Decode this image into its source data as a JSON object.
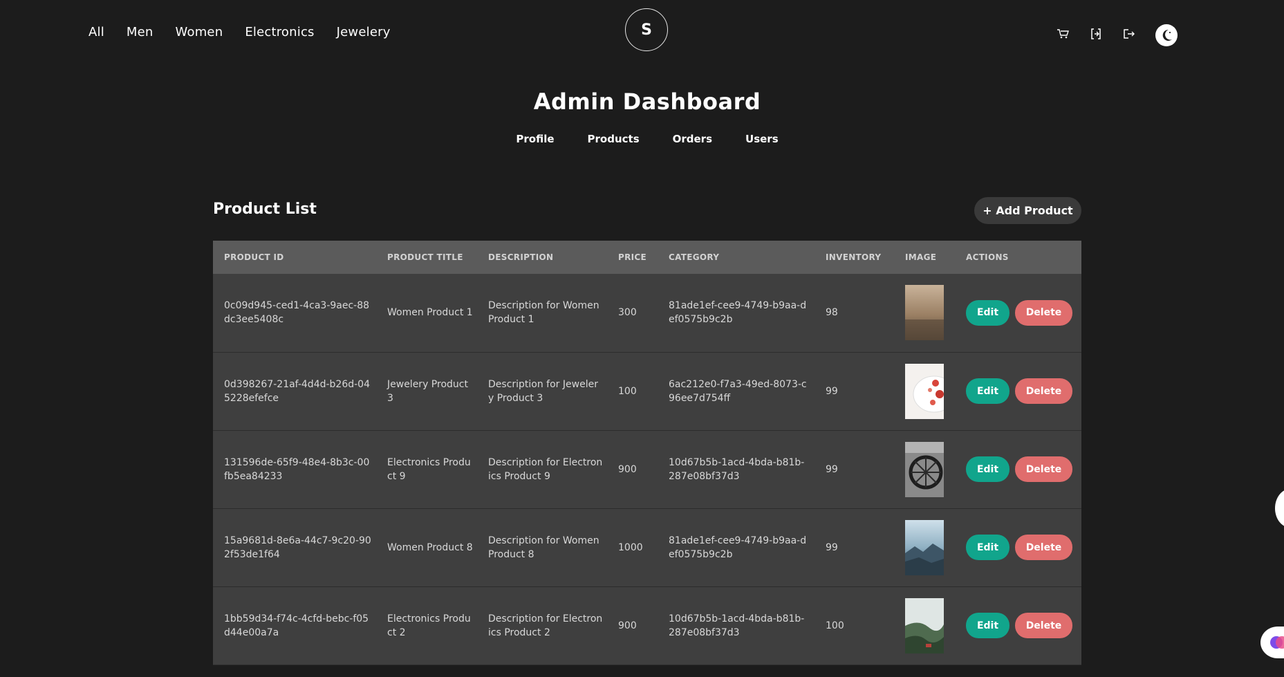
{
  "nav": {
    "links": [
      "All",
      "Men",
      "Women",
      "Electronics",
      "Jewelery"
    ]
  },
  "logo": {
    "letter": "S"
  },
  "header_icons": [
    "cart-icon",
    "login-icon",
    "logout-icon",
    "moon-icon"
  ],
  "dashboard": {
    "title": "Admin Dashboard",
    "tabs": [
      "Profile",
      "Products",
      "Orders",
      "Users"
    ]
  },
  "products": {
    "title": "Product List",
    "add_label": "+ Add Product",
    "columns": [
      "PRODUCT ID",
      "PRODUCT TITLE",
      "DESCRIPTION",
      "PRICE",
      "CATEGORY",
      "INVENTORY",
      "IMAGE",
      "ACTIONS"
    ],
    "edit_label": "Edit",
    "delete_label": "Delete",
    "rows": [
      {
        "id": "0c09d945-ced1-4ca3-9aec-88dc3ee5408c",
        "title": "Women Product 1",
        "description": "Description for Women Product 1",
        "price": "300",
        "category": "81ade1ef-cee9-4749-b9aa-def0575b9c2b",
        "inventory": "98",
        "image": "image-landscape-sepia"
      },
      {
        "id": "0d398267-21af-4d4d-b26d-045228efefce",
        "title": "Jewelery Product 3",
        "description": "Description for Jewelery Product 3",
        "price": "100",
        "category": "6ac212e0-f7a3-49ed-8073-c96ee7d754ff",
        "inventory": "99",
        "image": "image-strawberries-bowl"
      },
      {
        "id": "131596de-65f9-48e4-8b3c-00fb5ea84233",
        "title": "Electronics Product 9",
        "description": "Description for Electronics Product 9",
        "price": "900",
        "category": "10d67b5b-1acd-4bda-b81b-287e08bf37d3",
        "inventory": "99",
        "image": "image-wagon-wheel-bw"
      },
      {
        "id": "15a9681d-8e6a-44c7-9c20-902f53de1f64",
        "title": "Women Product 8",
        "description": "Description for Women Product 8",
        "price": "1000",
        "category": "81ade1ef-cee9-4749-b9aa-def0575b9c2b",
        "inventory": "99",
        "image": "image-mountain-valley"
      },
      {
        "id": "1bb59d34-f74c-4cfd-bebc-f05d44e00a7a",
        "title": "Electronics Product 2",
        "description": "Description for Electronics Product 2",
        "price": "900",
        "category": "10d67b5b-1acd-4bda-b81b-287e08bf37d3",
        "inventory": "100",
        "image": "image-green-hills"
      }
    ]
  },
  "colors": {
    "background": "#1c1c1c",
    "table_header": "#5b5b5b",
    "table_row": "#3f3f3f",
    "edit": "#11a58c",
    "delete": "#e06d6d",
    "add_button": "#3a3a3a"
  }
}
